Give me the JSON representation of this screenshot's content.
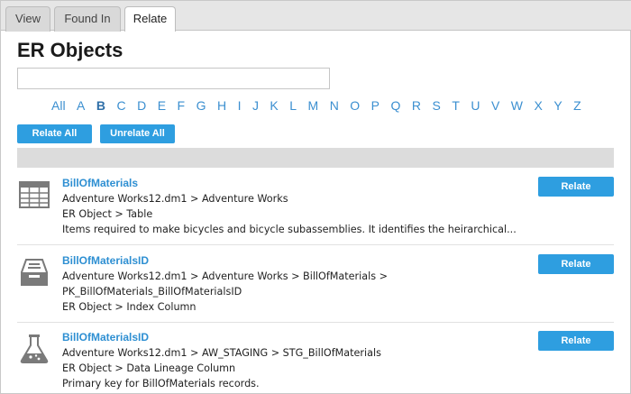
{
  "tabs": [
    {
      "label": "View"
    },
    {
      "label": "Found In"
    },
    {
      "label": "Relate",
      "active": true
    }
  ],
  "page_title": "ER Objects",
  "search": {
    "value": "",
    "placeholder": ""
  },
  "alphabet": [
    "All",
    "A",
    "B",
    "C",
    "D",
    "E",
    "F",
    "G",
    "H",
    "I",
    "J",
    "K",
    "L",
    "M",
    "N",
    "O",
    "P",
    "Q",
    "R",
    "S",
    "T",
    "U",
    "V",
    "W",
    "X",
    "Y",
    "Z"
  ],
  "alphabet_selected": "B",
  "buttons": {
    "relate_all": "Relate All",
    "unrelate_all": "Unrelate All"
  },
  "items": [
    {
      "name": "BillOfMaterials",
      "icon": "table-icon",
      "lines": [
        "Adventure Works12.dm1 > Adventure Works",
        "ER Object > Table",
        "Items required to make bicycles and bicycle subassemblies. It identifies the heirarchical..."
      ],
      "button": "Relate"
    },
    {
      "name": "BillOfMaterialsID",
      "icon": "index-column-icon",
      "lines": [
        "Adventure Works12.dm1 > Adventure Works > BillOfMaterials >",
        "PK_BillOfMaterials_BillOfMaterialsID",
        "ER Object > Index Column"
      ],
      "button": "Relate"
    },
    {
      "name": "BillOfMaterialsID",
      "icon": "flask-icon",
      "lines": [
        "Adventure Works12.dm1 > AW_STAGING > STG_BillOfMaterials",
        "ER Object > Data Lineage Column",
        "Primary key for BillOfMaterials records."
      ],
      "button": "Relate"
    }
  ],
  "colors": {
    "accent": "#2e9ee0",
    "link": "#2e8fd2",
    "band": "#dcdcdc"
  }
}
